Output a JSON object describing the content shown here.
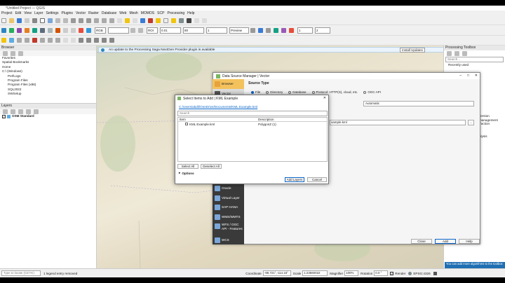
{
  "window": {
    "title": "*Untitled Project — QGIS"
  },
  "menu": [
    "Project",
    "Edit",
    "View",
    "Layer",
    "Settings",
    "Plugins",
    "Vector",
    "Raster",
    "Database",
    "Web",
    "Mesh",
    "MOMOS",
    "SCP",
    "Processing",
    "Help"
  ],
  "toolbar": {
    "scale_value": "0.01",
    "zoom_value": "80",
    "render": "1",
    "preview_label": "Preview",
    "rgb_label": "RGB",
    "roi_label": "ROI",
    "nums": [
      "1",
      "2"
    ]
  },
  "message_bar": {
    "text": "An update to the Processing Saga NextGen Provider plugin is available",
    "install_label": "Install Updates"
  },
  "browser": {
    "title": "Browser",
    "items": [
      "Favorites",
      "Spatial Bookmarks",
      "Home",
      "C:\\ (Windows)",
      "PerfLogs",
      "Program Files",
      "Program Files (x86)",
      "SQL2022",
      "SWSetup"
    ]
  },
  "layers": {
    "title": "Layers",
    "items": [
      "OSM Standard"
    ]
  },
  "toolbox": {
    "title": "Processing Toolbox",
    "search_placeholder": "Search...",
    "recent": "Recently used",
    "texts": [
      "version",
      "management",
      "traction",
      "alysis"
    ]
  },
  "dsm": {
    "title": "Data Source Manager | Vector",
    "side": [
      "Browser",
      "Vector",
      "Oracle",
      "Virtual Layer",
      "SAP HANA",
      "WMS/WMTS",
      "WFS / OGC API - Features",
      "WCS"
    ],
    "source_type_label": "Source Type",
    "radios": [
      "File",
      "Directory",
      "Database",
      "Protocol: HTTP(S), cloud, etc.",
      "OGC API"
    ],
    "encoding": "Automatic",
    "path_value": "xample.kml",
    "buttons": {
      "close": "Close",
      "add": "Add",
      "help": "Help"
    }
  },
  "select_dialog": {
    "title": "Select Items to Add | KML Example",
    "path": "C:/Users/abdil/OneDrive/Documents/KML Example.kml",
    "search_placeholder": "Search",
    "columns": [
      "Item",
      "Description"
    ],
    "rows": [
      {
        "item": "KML Example.kml",
        "description": "PolygonZ (1)"
      }
    ],
    "select_all": "Select All",
    "deselect_all": "Deselect All",
    "options_label": "Options",
    "add_layers": "Add Layers",
    "cancel": "Cancel"
  },
  "status": {
    "locate_placeholder": "Type to locate (Ctrl+K)",
    "legend_msg": "1 legend entry removed",
    "coordinate_label": "Coordinate",
    "coordinate": "-98.721°,-114.15°",
    "scale_label": "Scale",
    "scale": "1:23560022",
    "magnifier_label": "Magnifier",
    "magnifier": "100%",
    "rotation_label": "Rotation",
    "rotation": "0.0 °",
    "render_label": "Render",
    "crs": "EPSG:4326",
    "notice": "You can add more algorithms to the toolbox"
  },
  "colors": {
    "accent": "#0a64c8",
    "dialog_side": "#3a3a3a",
    "map_bg": "#e6dfc9"
  }
}
